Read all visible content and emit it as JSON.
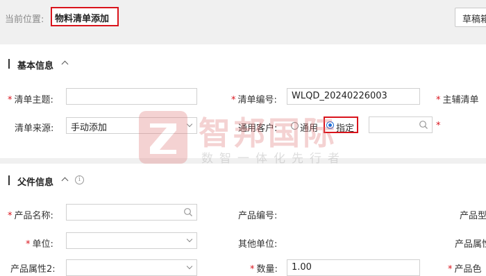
{
  "header": {
    "location_label": "当前位置:",
    "current_page": "物料清单添加",
    "draft_button": "草稿箱"
  },
  "basic_info": {
    "title": "基本信息",
    "list_subject": {
      "label": "清单主题:",
      "value": ""
    },
    "list_number": {
      "label": "清单编号:",
      "value": "WLQD_20240226003"
    },
    "main_aux": {
      "label": "主辅清单"
    },
    "list_source": {
      "label": "清单来源:",
      "value": "手动添加"
    },
    "general_customer": {
      "label": "通用客户:",
      "option_general": "通用",
      "option_specified": "指定",
      "selected": "指定"
    }
  },
  "parent_info": {
    "title": "父件信息",
    "product_name": {
      "label": "产品名称:",
      "value": ""
    },
    "product_number": {
      "label": "产品编号:"
    },
    "product_model": {
      "label": "产品型"
    },
    "unit": {
      "label": "单位:",
      "value": ""
    },
    "other_units": {
      "label": "其他单位:"
    },
    "product_attr": {
      "label": "产品属性"
    },
    "product_attr2": {
      "label": "产品属性2:"
    },
    "quantity": {
      "label": "数量:",
      "value": "1.00"
    },
    "product_color": {
      "label": "产品色"
    }
  },
  "watermark": {
    "brand": "智邦国际",
    "slogan": "数智一体化先行者"
  },
  "colors": {
    "highlight_red": "#d9131b",
    "required_red": "#d9131b",
    "radio_blue": "#1e6fd9",
    "header_gray": "#f0f0f0",
    "watermark_red": "#e07575"
  }
}
